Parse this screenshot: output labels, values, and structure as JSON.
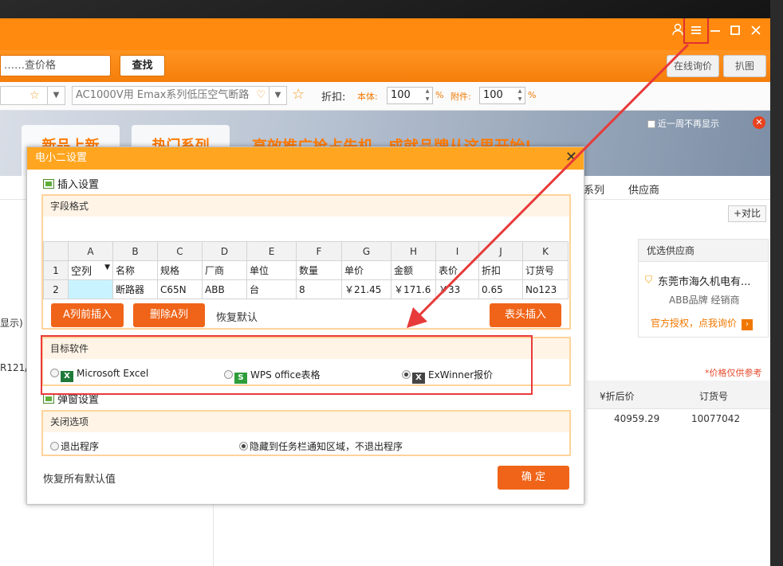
{
  "window": {
    "menu_icon": "hamburger-menu-icon",
    "user_icon": "user-icon",
    "minimize_icon": "minimize-icon",
    "maximize_icon": "maximize-icon",
    "close_icon": "close-icon"
  },
  "search": {
    "value": "……查价格",
    "find_label": "查找",
    "online_inquiry_label": "在线询价",
    "capture_label": "扒图"
  },
  "filter": {
    "product_select": "AC1000V用 Emax系列低压空气断路",
    "discount_label": "折扣:",
    "body_label": "本体:",
    "body_value": "100",
    "accessory_label": "附件:",
    "accessory_value": "100",
    "percent": "%"
  },
  "banner": {
    "tab_new": "新品上新",
    "tab_hot": "热门系列",
    "text": "高效推广抢占先机，成就品牌从这里开始!",
    "no_more_week": "近一周不再显示"
  },
  "background": {
    "tab_series": "系列",
    "tab_supplier": "供应商",
    "left_text_1": "显示)",
    "left_text_2": "R121/",
    "compare_label": "+对比",
    "supplier_head": "优选供应商",
    "supplier_name": "东莞市海久机电有...",
    "supplier_sub": "ABB品牌 经销商",
    "supplier_auth": "官方授权，点我询价",
    "price_note": "*价格仅供参考",
    "col_discount_price": "¥折后价",
    "col_order_no": "订货号",
    "row_discount_price": "40959.29",
    "row_order_no": "10077042"
  },
  "dialog": {
    "title": "电小二设置",
    "insert_settings": "插入设置",
    "field_format": "字段格式",
    "columns": [
      "A",
      "B",
      "C",
      "D",
      "E",
      "F",
      "G",
      "H",
      "I",
      "J",
      "K"
    ],
    "row1": [
      "空列",
      "名称",
      "规格",
      "厂商",
      "单位",
      "数量",
      "单价",
      "金额",
      "表价",
      "折扣",
      "订货号"
    ],
    "row2": [
      "",
      "断路器",
      "C65N",
      "ABB",
      "台",
      "8",
      "￥21.45",
      "￥171.6",
      "￥33",
      "0.65",
      "No123"
    ],
    "row_numbers": [
      "1",
      "2"
    ],
    "btn_insert_before_a": "A列前插入",
    "btn_delete_a": "删除A列",
    "restore_default": "恢复默认",
    "btn_header_insert": "表头插入",
    "target_software": "目标软件",
    "software_options": [
      "Microsoft Excel",
      "WPS office表格",
      "ExWinner报价"
    ],
    "selected_software": "ExWinner报价",
    "popup_settings": "弹窗设置",
    "close_options": "关闭选项",
    "close_opt_exit": "退出程序",
    "close_opt_hide": "隐藏到任务栏通知区域，不退出程序",
    "restore_all": "恢复所有默认值",
    "confirm": "确 定"
  },
  "colors": {
    "brand_orange": "#ff8a0f",
    "button_orange": "#f06419",
    "annotation_red": "#e83a3a"
  }
}
